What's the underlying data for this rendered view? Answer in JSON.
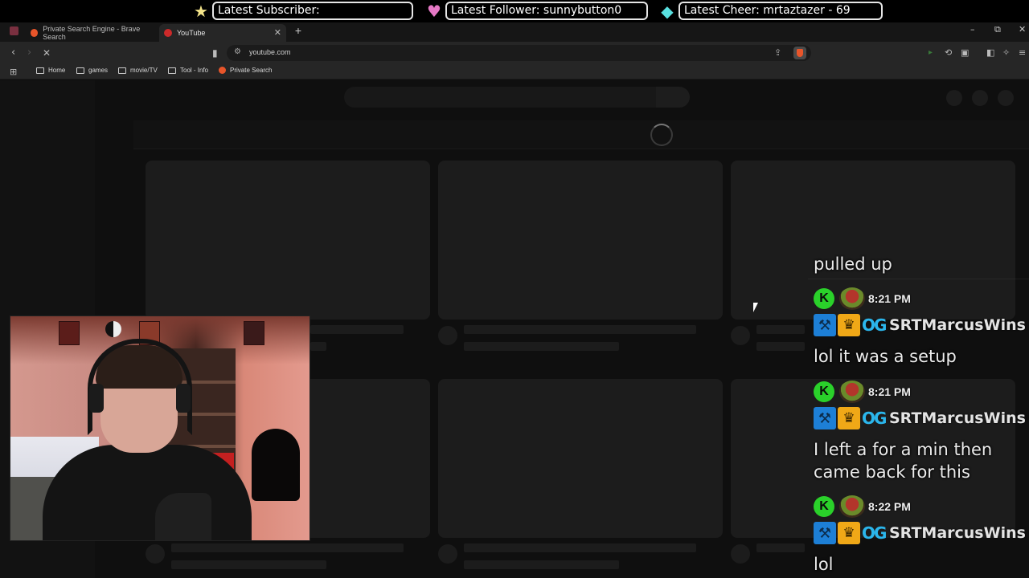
{
  "overlay": {
    "subscriber": {
      "icon": "star-icon",
      "glyph": "★",
      "color": "#f4e48a",
      "text": "Latest Subscriber:"
    },
    "follower": {
      "icon": "heart-icon",
      "glyph": "♥",
      "color": "#e679c6",
      "text": "Latest Follower: sunnybutton0"
    },
    "cheer": {
      "icon": "diamond-icon",
      "glyph": "◆",
      "color": "#59e0e0",
      "text": "Latest Cheer: mrtaztazer - 69"
    }
  },
  "browser": {
    "tabs": [
      {
        "title": "Private Search Engine - Brave Search",
        "active": false
      },
      {
        "title": "YouTube",
        "active": true
      }
    ],
    "new_tab_glyph": "+",
    "url": "youtube.com",
    "bookmarks": [
      {
        "label": "Home",
        "icon": "folder-icon"
      },
      {
        "label": "games",
        "icon": "folder-icon"
      },
      {
        "label": "movie/TV",
        "icon": "folder-icon"
      },
      {
        "label": "Tool - Info",
        "icon": "folder-icon"
      },
      {
        "label": "Private Search",
        "icon": "brave-icon"
      }
    ]
  },
  "chat": {
    "messages": [
      {
        "text": "pulled up"
      },
      {
        "time": "8:21 PM",
        "user": "SRTMarcusWins",
        "text": "lol it was a setup"
      },
      {
        "time": "8:21 PM",
        "user": "SRTMarcusWins",
        "text_lines": [
          "I left a for a min then",
          "came back for this"
        ]
      },
      {
        "time": "8:22 PM",
        "user": "SRTMarcusWins",
        "text": "lol"
      }
    ],
    "badges": {
      "platform": "K"
    }
  },
  "colors": {
    "page_bg": "#0f0f0f",
    "skeleton": "#1c1c1c",
    "kick_green": "#2ad12a",
    "brave_orange": "#e8552a"
  }
}
